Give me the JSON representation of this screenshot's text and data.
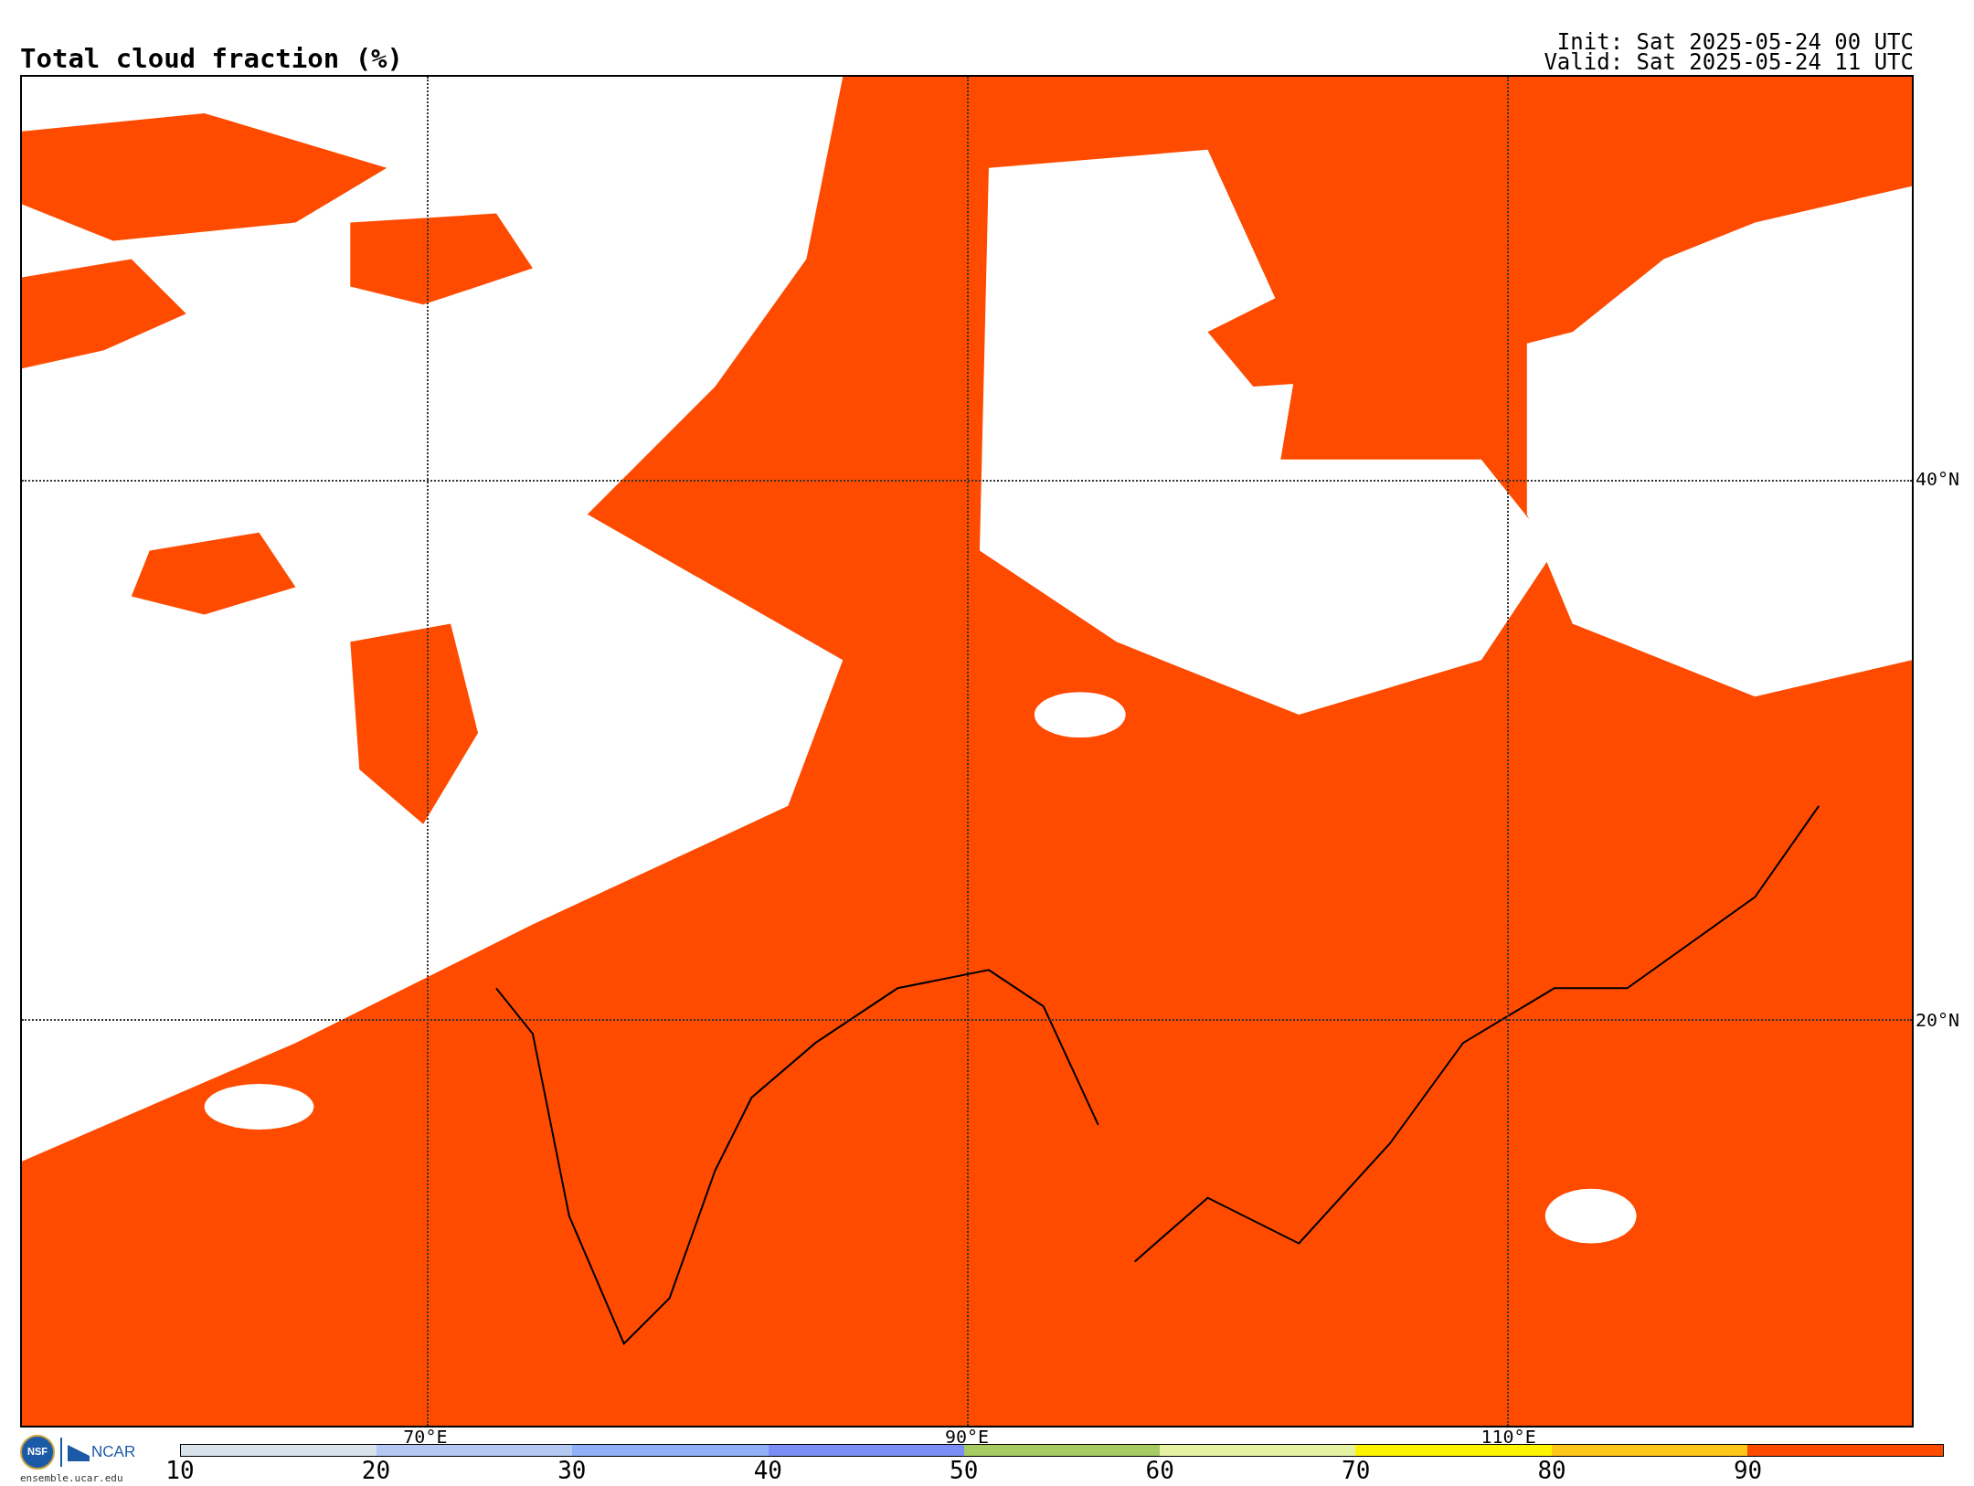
{
  "title": "Total cloud fraction (%)",
  "init": "Init: Sat 2025-05-24 00 UTC",
  "valid": "Valid: Sat 2025-05-24 11 UTC",
  "map": {
    "lat_labels": [
      "40°N",
      "20°N"
    ],
    "lon_labels": [
      "70°E",
      "90°E",
      "110°E"
    ]
  },
  "logos": {
    "nsf": "NSF",
    "ncar": "NCAR",
    "url": "ensemble.ucar.edu"
  },
  "colorbar": {
    "labels": [
      "10",
      "20",
      "30",
      "40",
      "50",
      "60",
      "70",
      "80",
      "90"
    ],
    "segments": [
      {
        "color": "#d9e3ec"
      },
      {
        "color": "#b4c8f4"
      },
      {
        "color": "#8fb0f6"
      },
      {
        "color": "#7b8ef5"
      },
      {
        "color": "#a6cb62"
      },
      {
        "color": "#e4f2a2"
      },
      {
        "color": "#fef400"
      },
      {
        "color": "#fdc71b"
      },
      {
        "color": "#fd4b00"
      }
    ]
  }
}
